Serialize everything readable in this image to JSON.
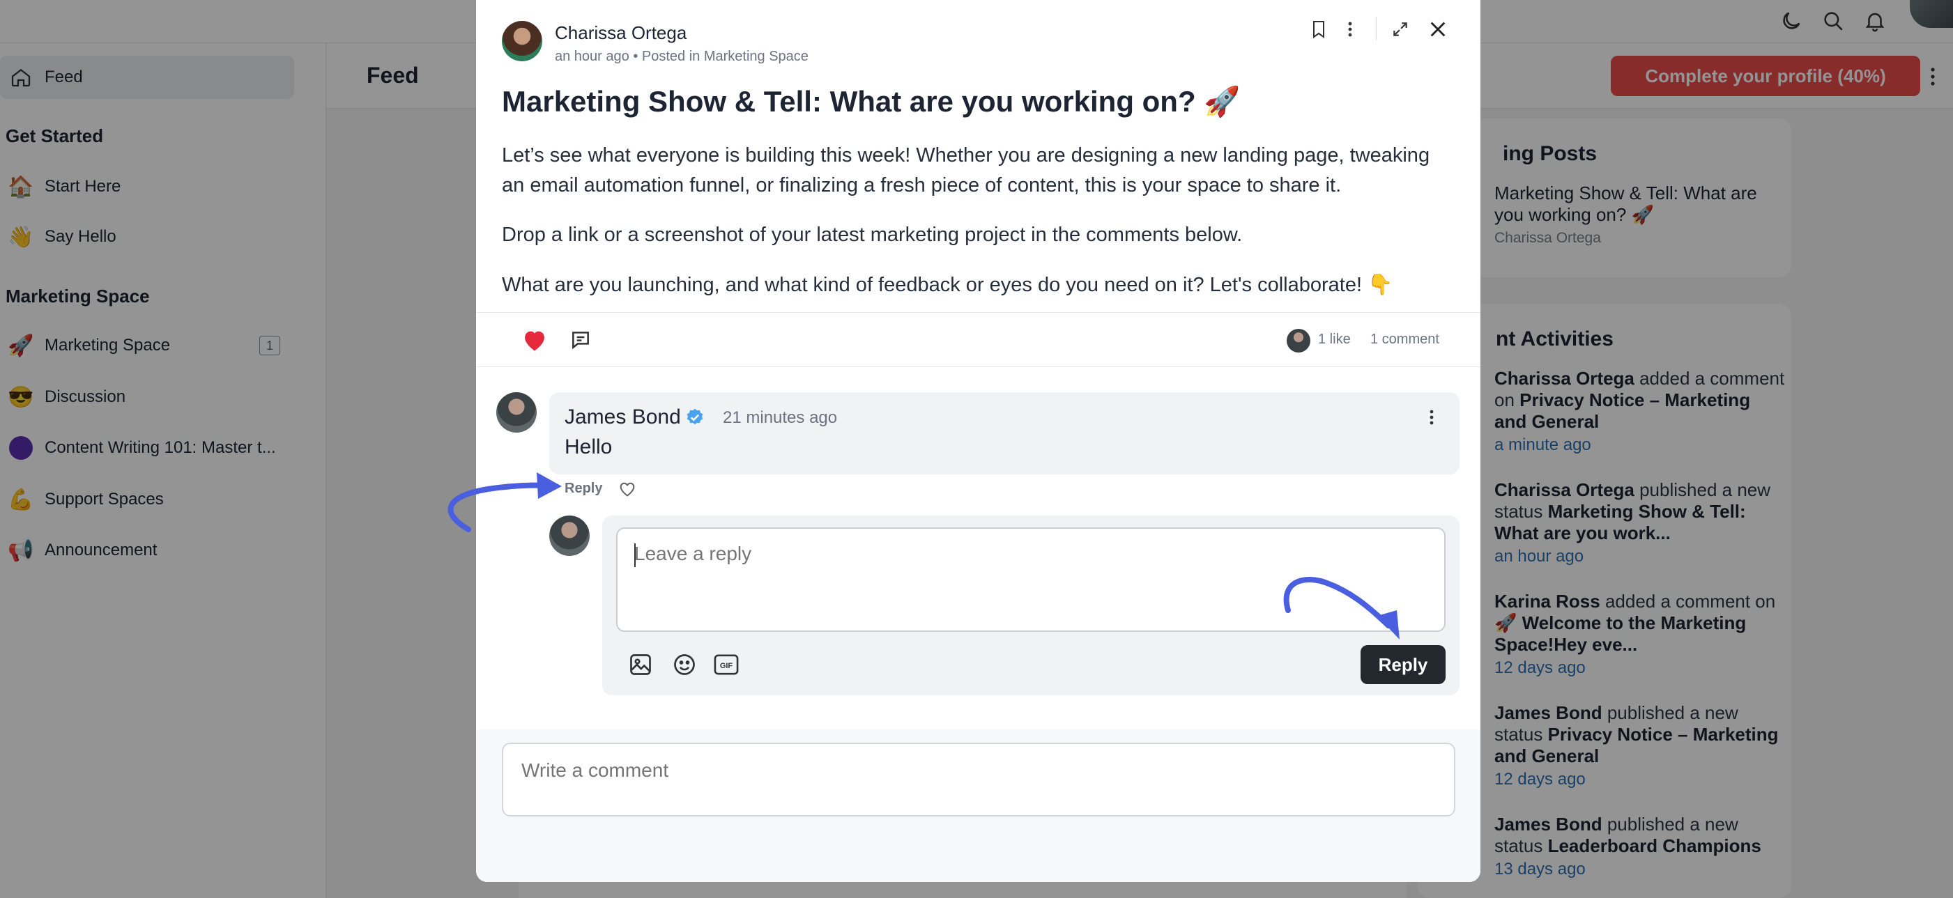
{
  "sidebar": {
    "feed": "Feed",
    "get_started": "Get Started",
    "start_here": "Start Here",
    "say_hello": "Say Hello",
    "marketing_space_heading": "Marketing Space",
    "items": [
      {
        "label": "Marketing Space",
        "badge": "1"
      },
      {
        "label": "Discussion"
      },
      {
        "label": "Content Writing 101: Master t..."
      },
      {
        "label": "Support Spaces"
      },
      {
        "label": "Announcement"
      }
    ]
  },
  "feedbar": {
    "title": "Feed",
    "complete_profile": "Complete your profile (40%)"
  },
  "right": {
    "trending_title": "ing Posts",
    "trending_post": {
      "title": "Marketing Show & Tell: What are you working on? 🚀",
      "author": "Charissa Ortega"
    },
    "activities_title": "nt Activities",
    "activities": [
      {
        "actor": "Charissa Ortega",
        "verb": " added a comment on ",
        "target": "Privacy Notice – Marketing and General",
        "time": "a minute ago"
      },
      {
        "actor": "Charissa Ortega",
        "verb": " published a new status ",
        "target": "Marketing Show & Tell: What are you work...",
        "time": "an hour ago"
      },
      {
        "actor": "Karina Ross",
        "verb": " added a comment on ",
        "target": "🚀 Welcome to the Marketing Space!Hey eve...",
        "time": "12 days ago"
      },
      {
        "actor": "James Bond",
        "verb": " published a new status ",
        "target": "Privacy Notice – Marketing and General",
        "time": "12 days ago"
      },
      {
        "actor": "James Bond",
        "verb": " published a new status ",
        "target": "Leaderboard Champions",
        "time": "13 days ago"
      }
    ]
  },
  "post": {
    "author": "Charissa Ortega",
    "meta": "an hour ago • Posted in Marketing Space",
    "title": "Marketing Show & Tell: What are you working on? 🚀",
    "paragraphs": [
      "Let’s see what everyone is building this week! Whether you are designing a new landing page, tweaking an email automation funnel, or finalizing a fresh piece of content, this is your space to share it.",
      "Drop a link or a screenshot of your latest marketing project in the comments below.",
      "What are you launching, and what kind of feedback or eyes do you need on it? Let's collaborate! 👇"
    ],
    "likes": "1 like",
    "comments": "1 comment"
  },
  "comment": {
    "author": "James Bond",
    "time": "21 minutes ago",
    "text": "Hello",
    "reply_link": "Reply"
  },
  "reply_form": {
    "placeholder": "Leave a reply",
    "submit": "Reply",
    "gif": "GIF"
  },
  "comment_form": {
    "placeholder": "Write a comment"
  },
  "colors": {
    "accent_red": "#e84b4b",
    "like_red": "#e5293a",
    "link_blue": "#2f6fb0",
    "annotation_blue": "#4a5fe0",
    "verified_blue": "#4aa3f0"
  }
}
